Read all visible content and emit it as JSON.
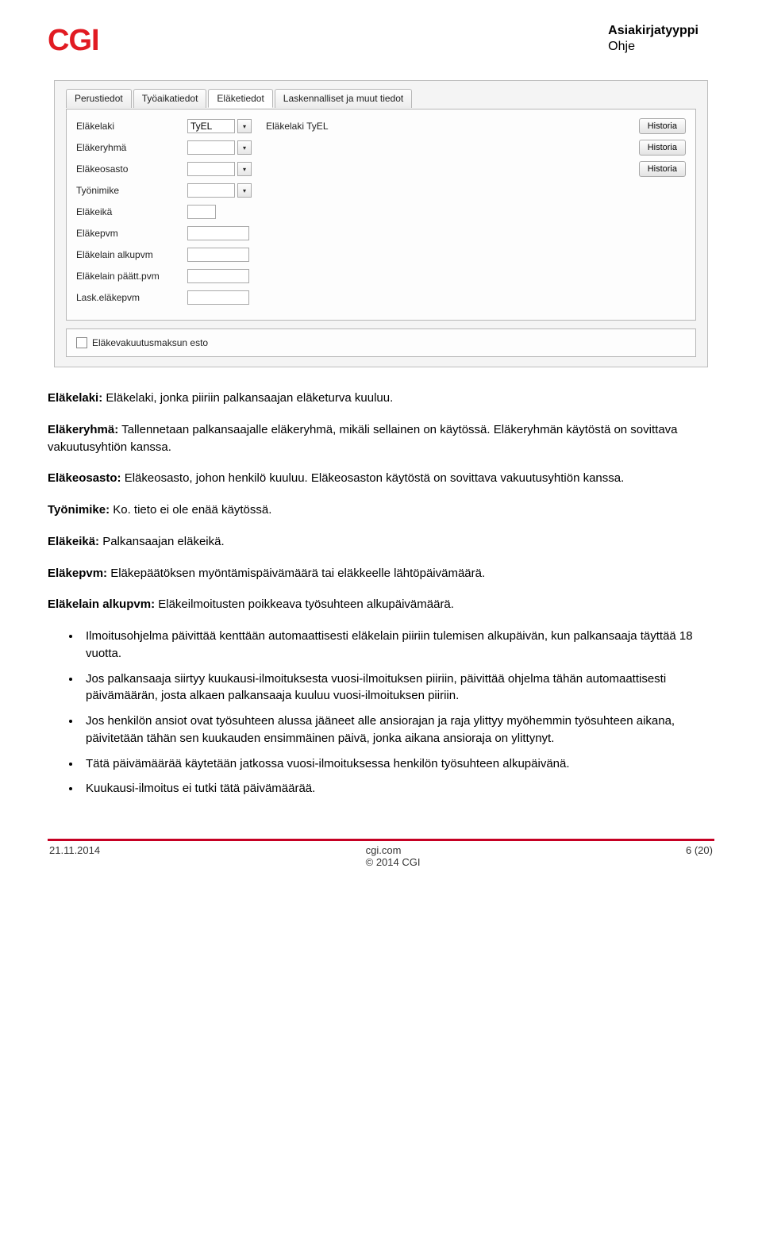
{
  "header": {
    "logo_text": "CGI",
    "doc_type_label": "Asiakirjatyyppi",
    "doc_type_value": "Ohje"
  },
  "ui": {
    "tabs": [
      {
        "label": "Perustiedot",
        "active": false
      },
      {
        "label": "Työaikatiedot",
        "active": false
      },
      {
        "label": "Eläketiedot",
        "active": true
      },
      {
        "label": "Laskennalliset ja muut tiedot",
        "active": false
      }
    ],
    "rows": {
      "elakelaki": {
        "label": "Eläkelaki",
        "value": "TyEL",
        "desc": "Eläkelaki TyEL",
        "hist": "Historia"
      },
      "elakeryhma": {
        "label": "Eläkeryhmä",
        "hist": "Historia"
      },
      "elakeosasto": {
        "label": "Eläkeosasto",
        "hist": "Historia"
      },
      "tyonimike": {
        "label": "Työnimike"
      },
      "elakeika": {
        "label": "Eläkeikä"
      },
      "elakepvm": {
        "label": "Eläkepvm"
      },
      "elakelain_alkupvm": {
        "label": "Eläkelain alkupvm"
      },
      "elakelain_paattpvm": {
        "label": "Eläkelain päätt.pvm"
      },
      "lask_elakepvm": {
        "label": "Lask.eläkepvm"
      }
    },
    "checkbox_label": "Eläkevakuutusmaksun esto"
  },
  "body": {
    "p1_term": "Eläkelaki:",
    "p1_text": " Eläkelaki, jonka piiriin palkansaajan eläketurva kuuluu.",
    "p2_term": "Eläkeryhmä:",
    "p2_text": " Tallennetaan palkansaajalle eläkeryhmä, mikäli sellainen on käytössä. Eläkeryhmän käytöstä on sovittava vakuutusyhtiön kanssa.",
    "p3_term": "Eläkeosasto:",
    "p3_text": " Eläkeosasto, johon henkilö kuuluu. Eläkeosaston käytöstä on sovittava vakuutusyhtiön kanssa.",
    "p4_term": "Työnimike:",
    "p4_text": " Ko. tieto ei ole enää käytössä.",
    "p5_term": "Eläkeikä:",
    "p5_text": " Palkansaajan eläkeikä.",
    "p6_term": "Eläkepvm:",
    "p6_text": " Eläkepäätöksen myöntämispäivämäärä tai eläkkeelle lähtöpäivämäärä.",
    "p7_term": "Eläkelain alkupvm:",
    "p7_text": " Eläkeilmoitusten poikkeava työsuhteen alkupäivämäärä.",
    "bullets": [
      "Ilmoitusohjelma päivittää kenttään automaattisesti eläkelain piiriin tulemisen alkupäivän, kun palkansaaja täyttää 18 vuotta.",
      "Jos palkansaaja siirtyy kuukausi-ilmoituksesta vuosi-ilmoituksen piiriin, päivittää ohjelma tähän automaattisesti päivämäärän, josta alkaen palkansaaja kuuluu vuosi-ilmoituksen piiriin.",
      "Jos henkilön ansiot ovat työsuhteen alussa jääneet alle ansiorajan ja raja ylittyy myöhemmin työsuhteen aikana, päivitetään tähän sen kuukauden ensimmäinen päivä, jonka aikana ansioraja on ylittynyt.",
      "Tätä päivämäärää käytetään jatkossa vuosi-ilmoituksessa henkilön työsuhteen alkupäivänä.",
      "Kuukausi-ilmoitus ei tutki tätä päivämäärää."
    ]
  },
  "footer": {
    "date": "21.11.2014",
    "site": "cgi.com",
    "copyright": "© 2014 CGI",
    "page": "6 (20)"
  }
}
